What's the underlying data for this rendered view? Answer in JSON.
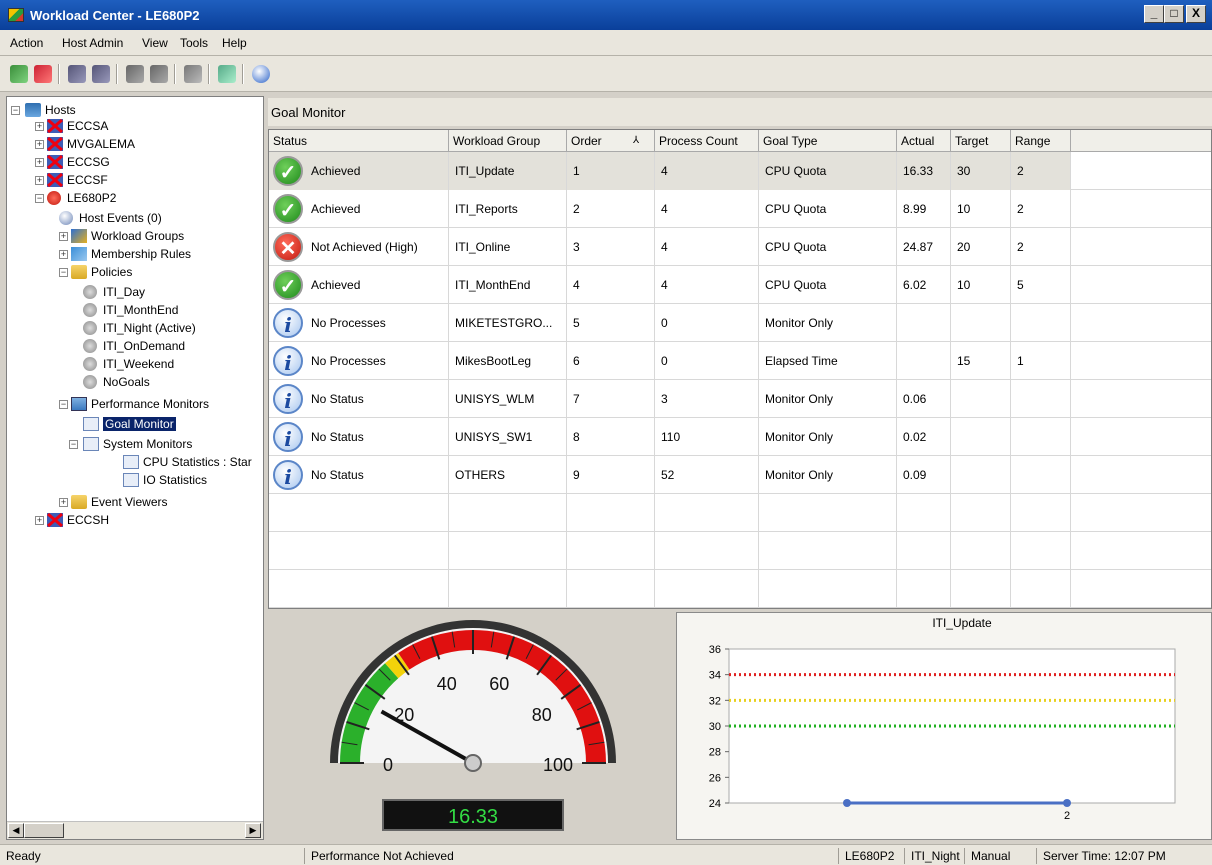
{
  "window": {
    "title": "Workload Center - LE680P2",
    "controls": [
      "_",
      "□",
      "X"
    ]
  },
  "menu": [
    "Action",
    "Host Admin",
    "View",
    "Tools",
    "Help"
  ],
  "tree": {
    "root": "Hosts",
    "hosts": [
      "ECCSA",
      "MVGALEMA",
      "ECCSG",
      "ECCSF",
      "LE680P2",
      "ECCSH"
    ],
    "host_events": "Host Events (0)",
    "workload_groups": "Workload Groups",
    "membership_rules": "Membership Rules",
    "policies": "Policies",
    "policy_items": [
      "ITI_Day",
      "ITI_MonthEnd",
      "ITI_Night (Active)",
      "ITI_OnDemand",
      "ITI_Weekend",
      "NoGoals"
    ],
    "performance_monitors": "Performance Monitors",
    "goal_monitor": "Goal Monitor",
    "system_monitors": "System Monitors",
    "cpu_statistics": "CPU Statistics : Star",
    "io_statistics": "IO Statistics",
    "event_viewers": "Event Viewers"
  },
  "goal_monitor": {
    "title": "Goal Monitor",
    "columns": [
      "Status",
      "Workload Group",
      "Order",
      "Process Count",
      "Goal Type",
      "Actual",
      "Target",
      "Range"
    ],
    "rows": [
      {
        "icon": "check-icon",
        "status": "Achieved",
        "group": "ITI_Update",
        "order": "1",
        "count": "4",
        "goal": "CPU Quota",
        "actual": "16.33",
        "target": "30",
        "range": "2"
      },
      {
        "icon": "check-icon",
        "status": "Achieved",
        "group": "ITI_Reports",
        "order": "2",
        "count": "4",
        "goal": "CPU Quota",
        "actual": "8.99",
        "target": "10",
        "range": "2"
      },
      {
        "icon": "error-icon",
        "status": "Not Achieved (High)",
        "group": "ITI_Online",
        "order": "3",
        "count": "4",
        "goal": "CPU Quota",
        "actual": "24.87",
        "target": "20",
        "range": "2"
      },
      {
        "icon": "check-icon",
        "status": "Achieved",
        "group": "ITI_MonthEnd",
        "order": "4",
        "count": "4",
        "goal": "CPU Quota",
        "actual": "6.02",
        "target": "10",
        "range": "5"
      },
      {
        "icon": "info-icon",
        "status": "No Processes",
        "group": "MIKETESTGRO...",
        "order": "5",
        "count": "0",
        "goal": "Monitor Only",
        "actual": "",
        "target": "",
        "range": ""
      },
      {
        "icon": "info-icon",
        "status": "No Processes",
        "group": "MikesBootLeg",
        "order": "6",
        "count": "0",
        "goal": "Elapsed Time",
        "actual": "",
        "target": "15",
        "range": "1"
      },
      {
        "icon": "info-icon",
        "status": "No Status",
        "group": "UNISYS_WLM",
        "order": "7",
        "count": "3",
        "goal": "Monitor Only",
        "actual": "0.06",
        "target": "",
        "range": ""
      },
      {
        "icon": "info-icon",
        "status": "No Status",
        "group": "UNISYS_SW1",
        "order": "8",
        "count": "110",
        "goal": "Monitor Only",
        "actual": "0.02",
        "target": "",
        "range": ""
      },
      {
        "icon": "info-icon",
        "status": "No Status",
        "group": "OTHERS",
        "order": "9",
        "count": "52",
        "goal": "Monitor Only",
        "actual": "0.09",
        "target": "",
        "range": ""
      }
    ]
  },
  "gauge": {
    "value": 16.33,
    "readout": "16.33",
    "min": 0,
    "max": 100,
    "labels": [
      "0",
      "20",
      "40",
      "60",
      "80",
      "100"
    ],
    "colors": {
      "green": "#2bb02b",
      "yellow": "#f2d20a",
      "red": "#e01010"
    }
  },
  "chart_data": {
    "type": "line",
    "title": "ITI_Update",
    "ylim": [
      24,
      36
    ],
    "yticks": [
      "24",
      "26",
      "28",
      "30",
      "32",
      "34",
      "36"
    ],
    "x_labels": [
      "2"
    ],
    "series": [
      {
        "values": [
          24,
          24
        ],
        "color": "#4a6fc4"
      }
    ],
    "reference_lines": [
      {
        "y": 34,
        "color": "#e02020"
      },
      {
        "y": 32,
        "color": "#e8d020"
      },
      {
        "y": 30,
        "color": "#20b020"
      }
    ]
  },
  "status_bar": {
    "ready": "Ready",
    "message": "Performance Not Achieved",
    "host": "LE680P2",
    "policy": "ITI_Night",
    "mode": "Manual",
    "server_time": "Server Time: 12:07 PM"
  }
}
